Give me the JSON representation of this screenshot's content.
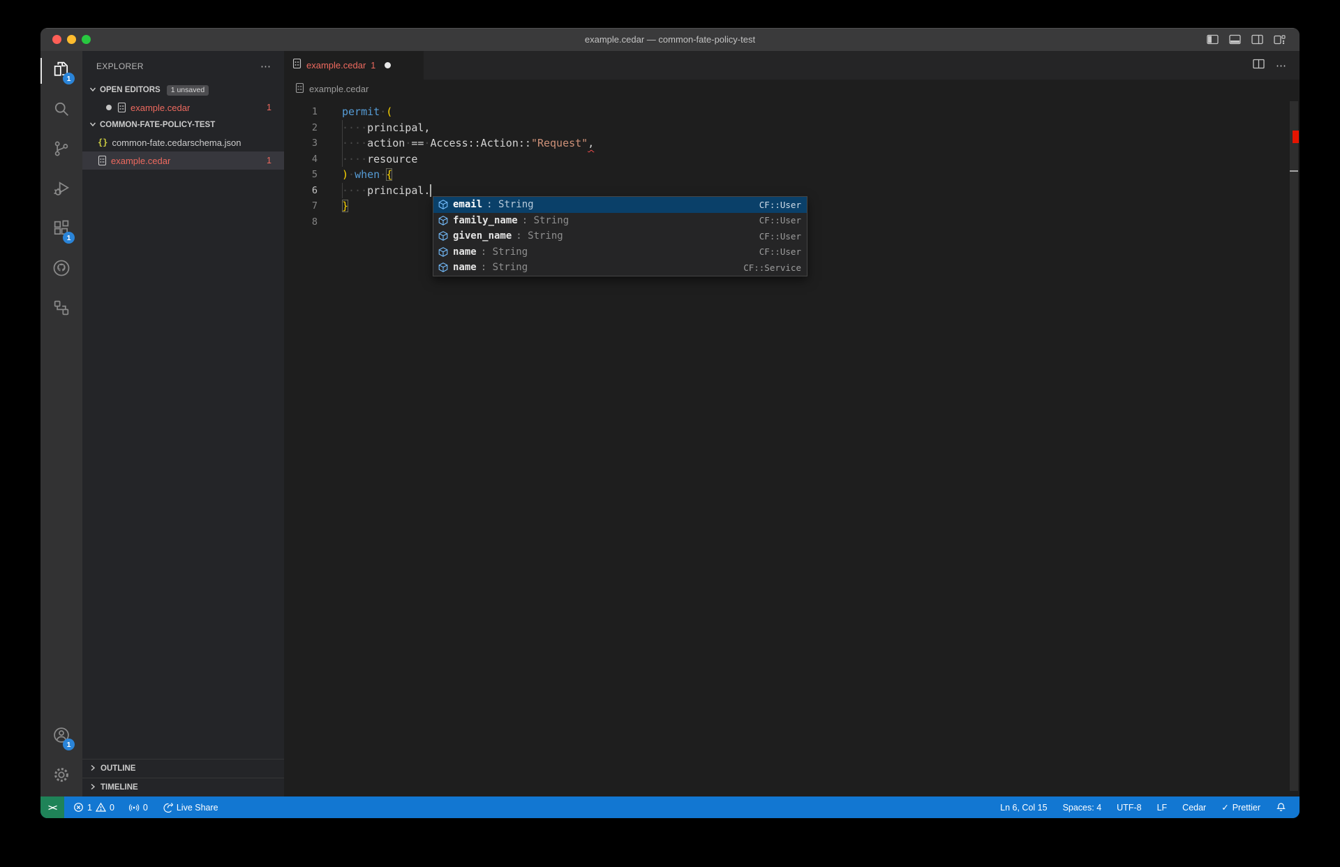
{
  "colors": {
    "statusbar-bg": "#1277d2",
    "remote-bg": "#1f8358",
    "badge-bg": "#2a84d8",
    "error-red": "#f14c4c",
    "file-error": "#ee6a5f",
    "keyword": "#569cd6",
    "string": "#ce9178",
    "bracket": "#ffd700",
    "suggest-selected": "#0a4069",
    "symbol-blue": "#75beff"
  },
  "icons": {
    "more": "⋯",
    "remote_glyph": "><",
    "check": "✓"
  },
  "window": {
    "title": "example.cedar — common-fate-policy-test"
  },
  "activity_bar": {
    "explorer_badge": "1",
    "extensions_badge": "1",
    "accounts_badge": "1"
  },
  "sidebar": {
    "title": "EXPLORER",
    "open_editors": {
      "label": "OPEN EDITORS",
      "badge": "1 unsaved",
      "items": [
        {
          "name": "example.cedar",
          "icon": "cedar",
          "error": "1",
          "modified": true
        }
      ]
    },
    "workspace": {
      "label": "COMMON-FATE-POLICY-TEST",
      "files": [
        {
          "name": "common-fate.cedarschema.json",
          "icon": "json"
        },
        {
          "name": "example.cedar",
          "icon": "cedar",
          "error": "1",
          "selected": true
        }
      ]
    },
    "outline_label": "OUTLINE",
    "timeline_label": "TIMELINE"
  },
  "editor": {
    "tab": {
      "label": "example.cedar",
      "error": "1"
    },
    "breadcrumb": "example.cedar",
    "lines": [
      {
        "num": "1",
        "tokens": [
          [
            "permit",
            "kw"
          ],
          [
            " ",
            "ws"
          ],
          [
            "(",
            "br"
          ]
        ]
      },
      {
        "num": "2",
        "indent_guide": true,
        "tokens": [
          [
            "    ",
            "ws"
          ],
          [
            "principal,",
            "pl"
          ]
        ]
      },
      {
        "num": "3",
        "indent_guide": true,
        "tokens": [
          [
            "    ",
            "ws"
          ],
          [
            "action",
            "pl"
          ],
          [
            " ",
            "ws"
          ],
          [
            "==",
            "pl"
          ],
          [
            " ",
            "ws"
          ],
          [
            "Access::Action::",
            "pl"
          ],
          [
            "\"Request\"",
            "str"
          ],
          [
            ",",
            "err"
          ]
        ]
      },
      {
        "num": "4",
        "indent_guide": true,
        "tokens": [
          [
            "    ",
            "ws"
          ],
          [
            "resource",
            "pl"
          ]
        ]
      },
      {
        "num": "5",
        "tokens": [
          [
            ")",
            "br"
          ],
          [
            " ",
            "ws"
          ],
          [
            "when",
            "kw"
          ],
          [
            " ",
            "ws"
          ],
          [
            "{",
            "brm"
          ]
        ]
      },
      {
        "num": "6",
        "active": true,
        "cursor": true,
        "indent_guide": true,
        "tokens": [
          [
            "    ",
            "ws"
          ],
          [
            "principal.",
            "pl"
          ]
        ]
      },
      {
        "num": "7",
        "tokens": [
          [
            "}",
            "brm"
          ]
        ]
      },
      {
        "num": "8",
        "tokens": []
      }
    ]
  },
  "suggest": {
    "items": [
      {
        "label": "email",
        "detail": ": String",
        "source": "CF::User",
        "selected": true
      },
      {
        "label": "family_name",
        "detail": ": String",
        "source": "CF::User"
      },
      {
        "label": "given_name",
        "detail": ": String",
        "source": "CF::User"
      },
      {
        "label": "name",
        "detail": ": String",
        "source": "CF::User"
      },
      {
        "label": "name",
        "detail": ": String",
        "source": "CF::Service"
      }
    ]
  },
  "status_bar": {
    "errors": "1",
    "warnings": "0",
    "ports": "0",
    "live_share": "Live Share",
    "cursor_position": "Ln 6, Col 15",
    "indentation": "Spaces: 4",
    "encoding": "UTF-8",
    "eol": "LF",
    "language": "Cedar",
    "formatter": "Prettier"
  }
}
